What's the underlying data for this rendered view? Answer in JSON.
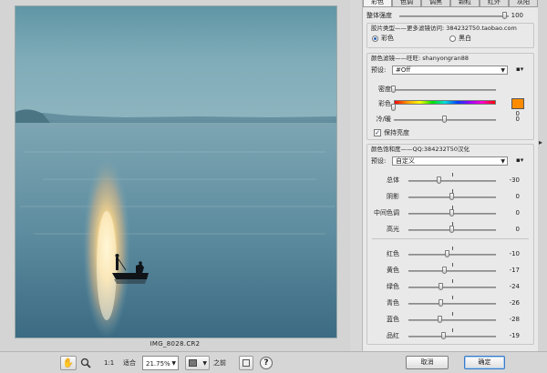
{
  "preview": {
    "filename": "IMG_8028.CR2"
  },
  "toolbar": {
    "ratio_label": "1:1",
    "fit_label": "适合",
    "zoom_value": "21.75%",
    "before_label": "之前",
    "help_glyph": "?",
    "cancel_label": "取消",
    "ok_label": "确定"
  },
  "panel": {
    "tabs": [
      "彩色",
      "色调",
      "调黑",
      "颗粒",
      "红外",
      "灰阳"
    ],
    "active_tab": 0,
    "overall": {
      "label": "整体强度",
      "value": "100",
      "level": 0.97
    },
    "film_type": {
      "title": "胶片类型——更多滤镜访问: 384232T50.taobao.com",
      "options": [
        "彩色",
        "黑白"
      ],
      "selected": 0
    },
    "color_filter": {
      "title": "颜色滤镜——旺旺: shanyongran88",
      "preset_label": "预设:",
      "preset_value": "#Off",
      "density": {
        "label": "密度",
        "level": 0.0
      },
      "color": {
        "label": "彩色",
        "swatch": "#ff8c00",
        "value": "0",
        "level": 0.0
      },
      "warm": {
        "label": "冷/暖",
        "value": "0",
        "level": 0.5
      },
      "preserve": {
        "label": "保持亮度",
        "checked": true
      }
    },
    "saturation": {
      "title": "颜色饱和度——QQ:384232T50汉化",
      "preset_label": "预设:",
      "preset_value": "自定义",
      "tonal": [
        {
          "label": "总体",
          "value": "-30",
          "level": 0.35
        },
        {
          "label": "阴影",
          "value": "0",
          "level": 0.5
        },
        {
          "label": "中间色调",
          "value": "0",
          "level": 0.5
        },
        {
          "label": "高光",
          "value": "0",
          "level": 0.5
        }
      ],
      "colors": [
        {
          "label": "红色",
          "value": "-10",
          "level": 0.45
        },
        {
          "label": "黄色",
          "value": "-17",
          "level": 0.415
        },
        {
          "label": "绿色",
          "value": "-24",
          "level": 0.38
        },
        {
          "label": "青色",
          "value": "-26",
          "level": 0.37
        },
        {
          "label": "蓝色",
          "value": "-28",
          "level": 0.36
        },
        {
          "label": "品红",
          "value": "-19",
          "level": 0.405
        }
      ]
    }
  },
  "colors": {
    "accent": "#3a79c6",
    "swatch": "#ff8c00"
  },
  "icons": [
    "hand-icon",
    "zoom-icon",
    "layout-icon",
    "help-icon",
    "menu-icon",
    "chevron-down-icon"
  ]
}
